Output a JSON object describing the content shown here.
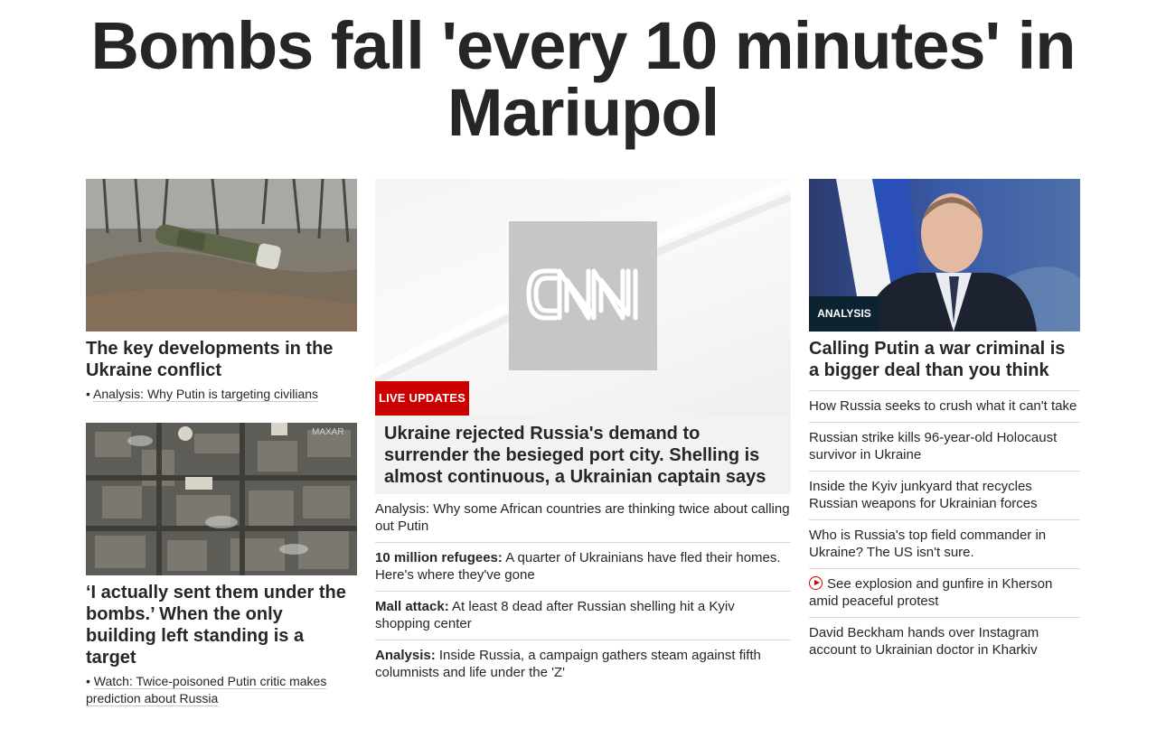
{
  "page": {
    "headline": "Bombs fall 'every 10 minutes' in Mariupol"
  },
  "left": {
    "card1": {
      "image_alt": "missile-in-field",
      "title": "The key developments in the Ukraine conflict",
      "bullet": "Analysis: Why Putin is targeting civilians"
    },
    "card2": {
      "image_alt": "aerial-city-view",
      "watermark": "MAXAR",
      "title": "‘I actually sent them under the bombs.’ When the only building left standing is a target",
      "bullet": "Watch: Twice-poisoned Putin critic makes prediction about Russia"
    }
  },
  "middle": {
    "logo": "CNN",
    "badge": "LIVE UPDATES",
    "hero_title": "Ukraine rejected Russia's demand to surrender the besieged port city. Shelling is almost continuous, a Ukrainian captain says",
    "items": [
      {
        "prefix": "",
        "text": "Analysis: Why some African countries are thinking twice about calling out Putin"
      },
      {
        "prefix": "10 million refugees:",
        "text": " A quarter of Ukrainians have fled their homes. Here's where they've gone"
      },
      {
        "prefix": "Mall attack:",
        "text": " At least 8 dead after Russian shelling hit a Kyiv shopping center"
      },
      {
        "prefix": "Analysis:",
        "text": " Inside Russia, a campaign gathers steam against fifth columnists and life under the 'Z'"
      }
    ]
  },
  "right": {
    "badge": "ANALYSIS",
    "image_alt": "putin-portrait",
    "title": "Calling Putin a war criminal is a bigger deal than you think",
    "items": [
      {
        "text": "How Russia seeks to crush what it can't take",
        "icon": ""
      },
      {
        "text": "Russian strike kills 96-year-old Holocaust survivor in Ukraine",
        "icon": ""
      },
      {
        "text": "Inside the Kyiv junkyard that recycles Russian weapons for Ukrainian forces",
        "icon": ""
      },
      {
        "text": "Who is Russia's top field commander in Ukraine? The US isn't sure.",
        "icon": ""
      },
      {
        "text": "See explosion and gunfire in Kherson amid peaceful protest",
        "icon": "play-icon"
      },
      {
        "text": "David Beckham hands over Instagram account to Ukrainian doctor in Kharkiv",
        "icon": ""
      }
    ]
  },
  "colors": {
    "text": "#262626",
    "live_red": "#cc0000",
    "analysis_navy": "#0c2331"
  }
}
